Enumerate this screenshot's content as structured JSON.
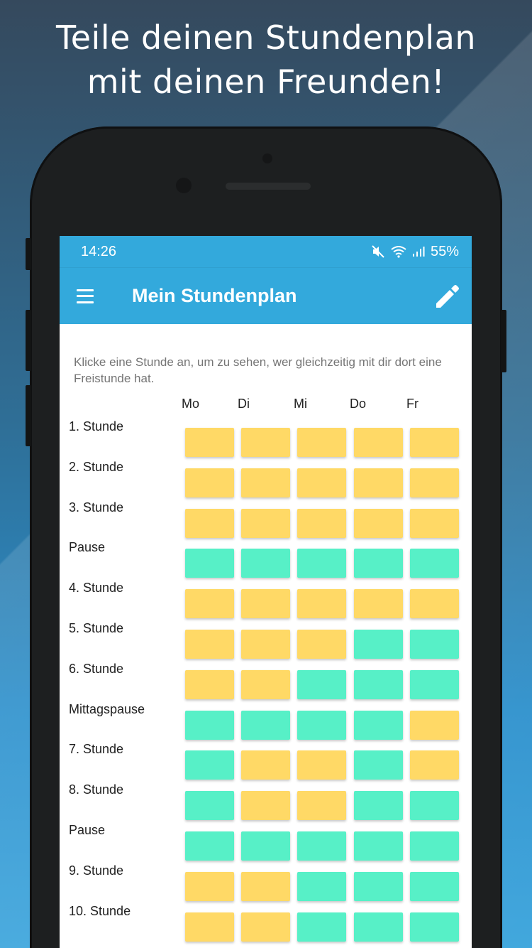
{
  "headline": {
    "line1": "Teile deinen Stundenplan",
    "line2": "mit deinen Freunden!"
  },
  "status": {
    "time": "14:26",
    "battery": "55%",
    "icons": [
      "mute-icon",
      "wifi-icon",
      "signal-icon"
    ]
  },
  "toolbar": {
    "title": "Mein Stundenplan",
    "menu_icon": "hamburger-menu-icon",
    "edit_icon": "pencil-icon"
  },
  "hint": "Klicke eine Stunde an, um zu sehen, wer gleichzeitig mit dir dort eine Freistunde hat.",
  "days": [
    "Mo",
    "Di",
    "Mi",
    "Do",
    "Fr"
  ],
  "colors": {
    "busy": "#ffd966",
    "free": "#57f0c7",
    "accent": "#33a9dc"
  },
  "rows": [
    {
      "label": "1. Stunde",
      "cells": [
        "busy",
        "busy",
        "busy",
        "busy",
        "busy"
      ]
    },
    {
      "label": "2. Stunde",
      "cells": [
        "busy",
        "busy",
        "busy",
        "busy",
        "busy"
      ]
    },
    {
      "label": "3. Stunde",
      "cells": [
        "busy",
        "busy",
        "busy",
        "busy",
        "busy"
      ]
    },
    {
      "label": "Pause",
      "cells": [
        "free",
        "free",
        "free",
        "free",
        "free"
      ]
    },
    {
      "label": "4. Stunde",
      "cells": [
        "busy",
        "busy",
        "busy",
        "busy",
        "busy"
      ]
    },
    {
      "label": "5. Stunde",
      "cells": [
        "busy",
        "busy",
        "busy",
        "free",
        "free"
      ]
    },
    {
      "label": "6. Stunde",
      "cells": [
        "busy",
        "busy",
        "free",
        "free",
        "free"
      ]
    },
    {
      "label": "Mittagspause",
      "cells": [
        "free",
        "free",
        "free",
        "free",
        "busy"
      ]
    },
    {
      "label": "7. Stunde",
      "cells": [
        "free",
        "busy",
        "busy",
        "free",
        "busy"
      ]
    },
    {
      "label": "8. Stunde",
      "cells": [
        "free",
        "busy",
        "busy",
        "free",
        "free"
      ]
    },
    {
      "label": "Pause",
      "cells": [
        "free",
        "free",
        "free",
        "free",
        "free"
      ]
    },
    {
      "label": "9. Stunde",
      "cells": [
        "busy",
        "busy",
        "free",
        "free",
        "free"
      ]
    },
    {
      "label": "10. Stunde",
      "cells": [
        "busy",
        "busy",
        "free",
        "free",
        "free"
      ]
    }
  ]
}
